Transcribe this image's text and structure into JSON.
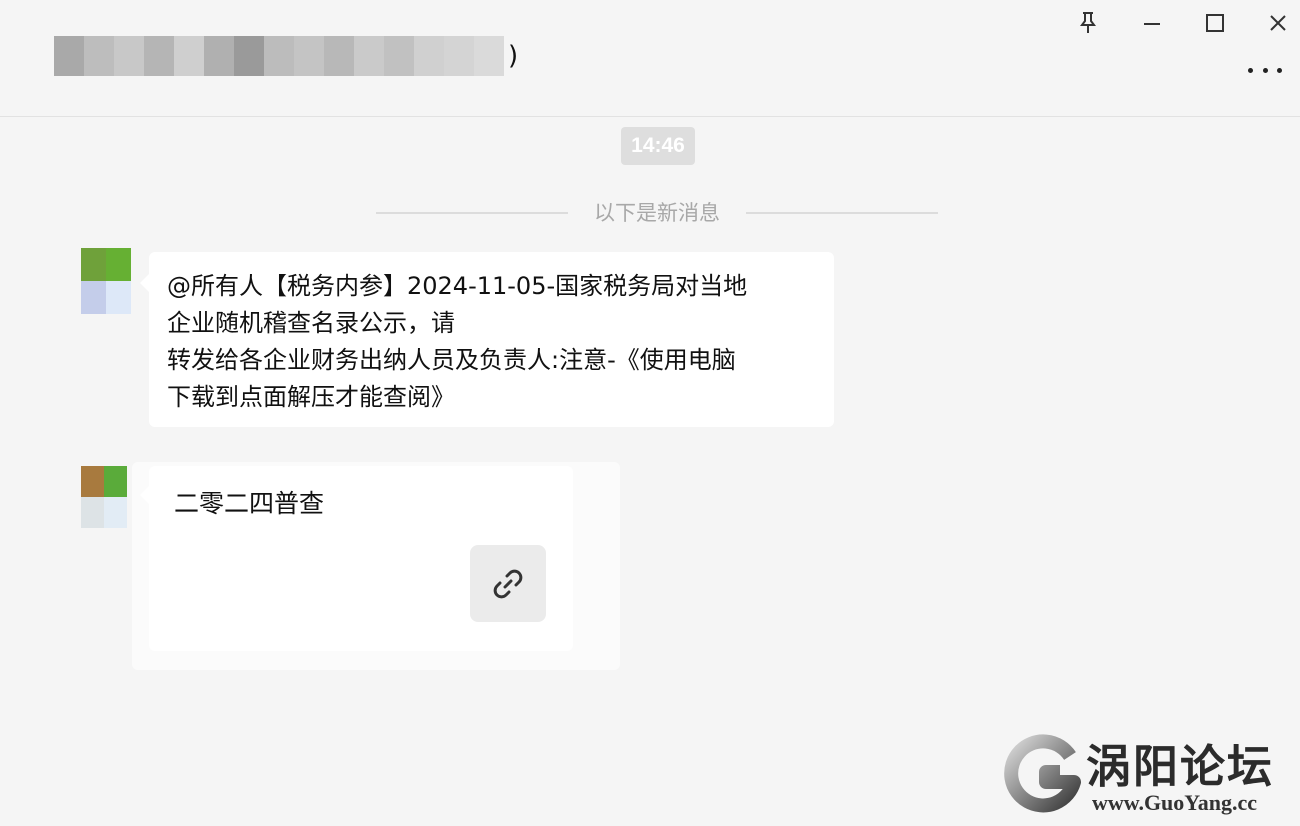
{
  "header": {
    "chat_title_suffix": ")",
    "icons": [
      "pin-icon",
      "minimize-icon",
      "maximize-icon",
      "close-icon",
      "more-icon"
    ]
  },
  "chat": {
    "timestamp": "14:46",
    "new_messages_label": "以下是新消息",
    "messages": [
      {
        "type": "text",
        "lines": [
          "@所有人【税务内参】2024-11-05-国家税务局对当地",
          "企业随机稽查名录公示，请",
          "转发给各企业财务出纳人员及负责人:注意-《使用电脑",
          "下载到点面解压才能查阅》"
        ]
      },
      {
        "type": "link-card",
        "title": "二零二四普查",
        "icon": "link-icon"
      }
    ]
  },
  "watermark": {
    "text": "涡阳论坛",
    "url": "www.GuoYang.cc"
  }
}
